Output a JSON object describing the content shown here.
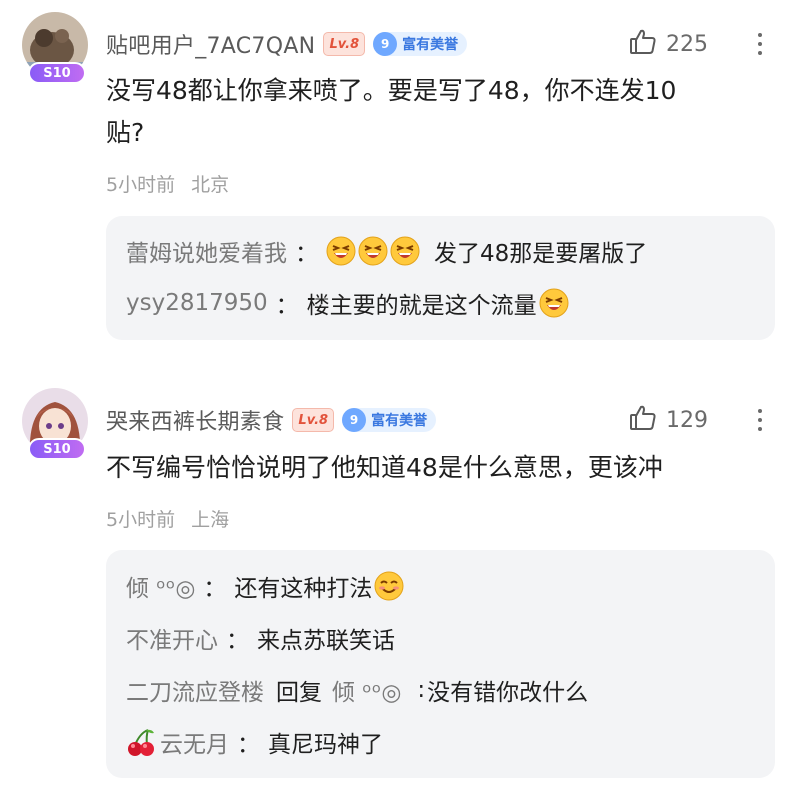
{
  "comments": [
    {
      "username": "贴吧用户_7AC7QAN",
      "level": "Lv.8",
      "rank_num": "9",
      "rank_label": "富有美誉",
      "avatar_badge": "S10",
      "likes": "225",
      "content_line1": "没写48都让你拿来喷了。要是写了48，你不连发10",
      "content_line2": "贴?",
      "time": "5小时前",
      "location": "北京",
      "replies": [
        {
          "user": "蕾姆说她爱着我",
          "sep": "：",
          "text": "发了48那是要屠版了",
          "emoji": [
            "grin-squint",
            "grin-squint",
            "grin-squint"
          ]
        },
        {
          "user": "ysy2817950",
          "sep": "：",
          "text": "楼主要的就是这个流量",
          "emoji_after": "grin-squint"
        }
      ]
    },
    {
      "username": "哭来西裤长期素食",
      "level": "Lv.8",
      "rank_num": "9",
      "rank_label": "富有美誉",
      "avatar_badge": "S10",
      "likes": "129",
      "content_line1": "不写编号恰恰说明了他知道48是什么意思，更该冲",
      "time": "5小时前",
      "location": "上海",
      "replies": [
        {
          "user": "倾 ᵒᵒ◎",
          "sep": "：",
          "text": "还有这种打法",
          "emoji_after": "smile-relieved"
        },
        {
          "user": "不准开心",
          "sep": "：",
          "text": "来点苏联笑话"
        },
        {
          "user": "二刀流应登楼",
          "reply_word": "回复",
          "reply_to": "倾 ᵒᵒ◎",
          "sep": ":",
          "text": "没有错你改什么"
        },
        {
          "user": "云无月",
          "user_icon": "cherry-icon",
          "sep": "：",
          "text": "真尼玛神了"
        }
      ]
    }
  ]
}
